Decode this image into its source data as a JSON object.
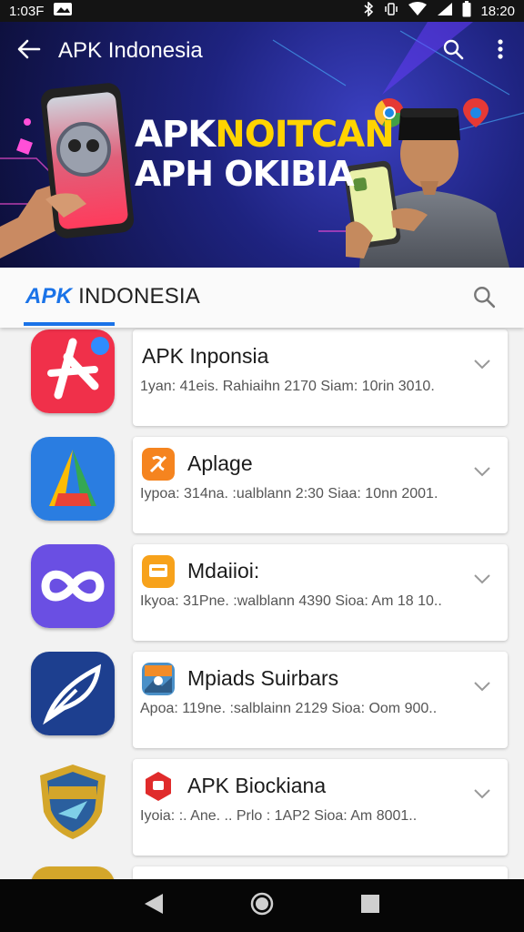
{
  "status_bar": {
    "left_text": "1:03F",
    "time": "18:20",
    "icons": [
      "image-icon",
      "bluetooth-icon",
      "wifi-icon",
      "signal-icon",
      "battery-icon"
    ]
  },
  "toolbar": {
    "title": "APK Indonesia",
    "icons": [
      "back-arrow-icon",
      "search-icon",
      "more-vert-icon"
    ]
  },
  "hero": {
    "line1_white": "APK",
    "line1_yellow": "NOITCAN",
    "line2": "APH OKIBIA"
  },
  "tabs": {
    "active_blue": "APK",
    "active_rest": " INDONESIA"
  },
  "apps": [
    {
      "title": "APK Inponsia",
      "subtitle": "1yan: 41eis. Rahiaihn 2170 Siam: 10rin 3010.",
      "icon": "app-red-icon",
      "small_icon": null
    },
    {
      "title": "Aplage",
      "subtitle": "Iypoa: 314na. :ualblann 2:30 Siaa: 10nn 2001.",
      "icon": "app-triangle-icon",
      "small_icon": "orange-puzzle-icon"
    },
    {
      "title": "Mdaiioi:",
      "subtitle": "Ikyoa: 31Pne. :walblann 4390 Sioa: Am 18 10..",
      "icon": "app-infinity-icon",
      "small_icon": "orange-card-icon"
    },
    {
      "title": "Mpiads Suirbars",
      "subtitle": "Apoa: 119ne. :salblainn 2129 Sioa: Oom 900..",
      "icon": "app-feather-icon",
      "small_icon": "landscape-icon"
    },
    {
      "title": "APK Biockiana",
      "subtitle": "Iyoia: :. Ane. .. Prlo : 1AP2 Sioa: Am 8001..",
      "icon": "app-shield-icon",
      "small_icon": "red-hexagon-icon"
    }
  ],
  "colors": {
    "accent": "#1a73e8",
    "hero_yellow": "#ffd400",
    "status_bar": "#141414"
  }
}
